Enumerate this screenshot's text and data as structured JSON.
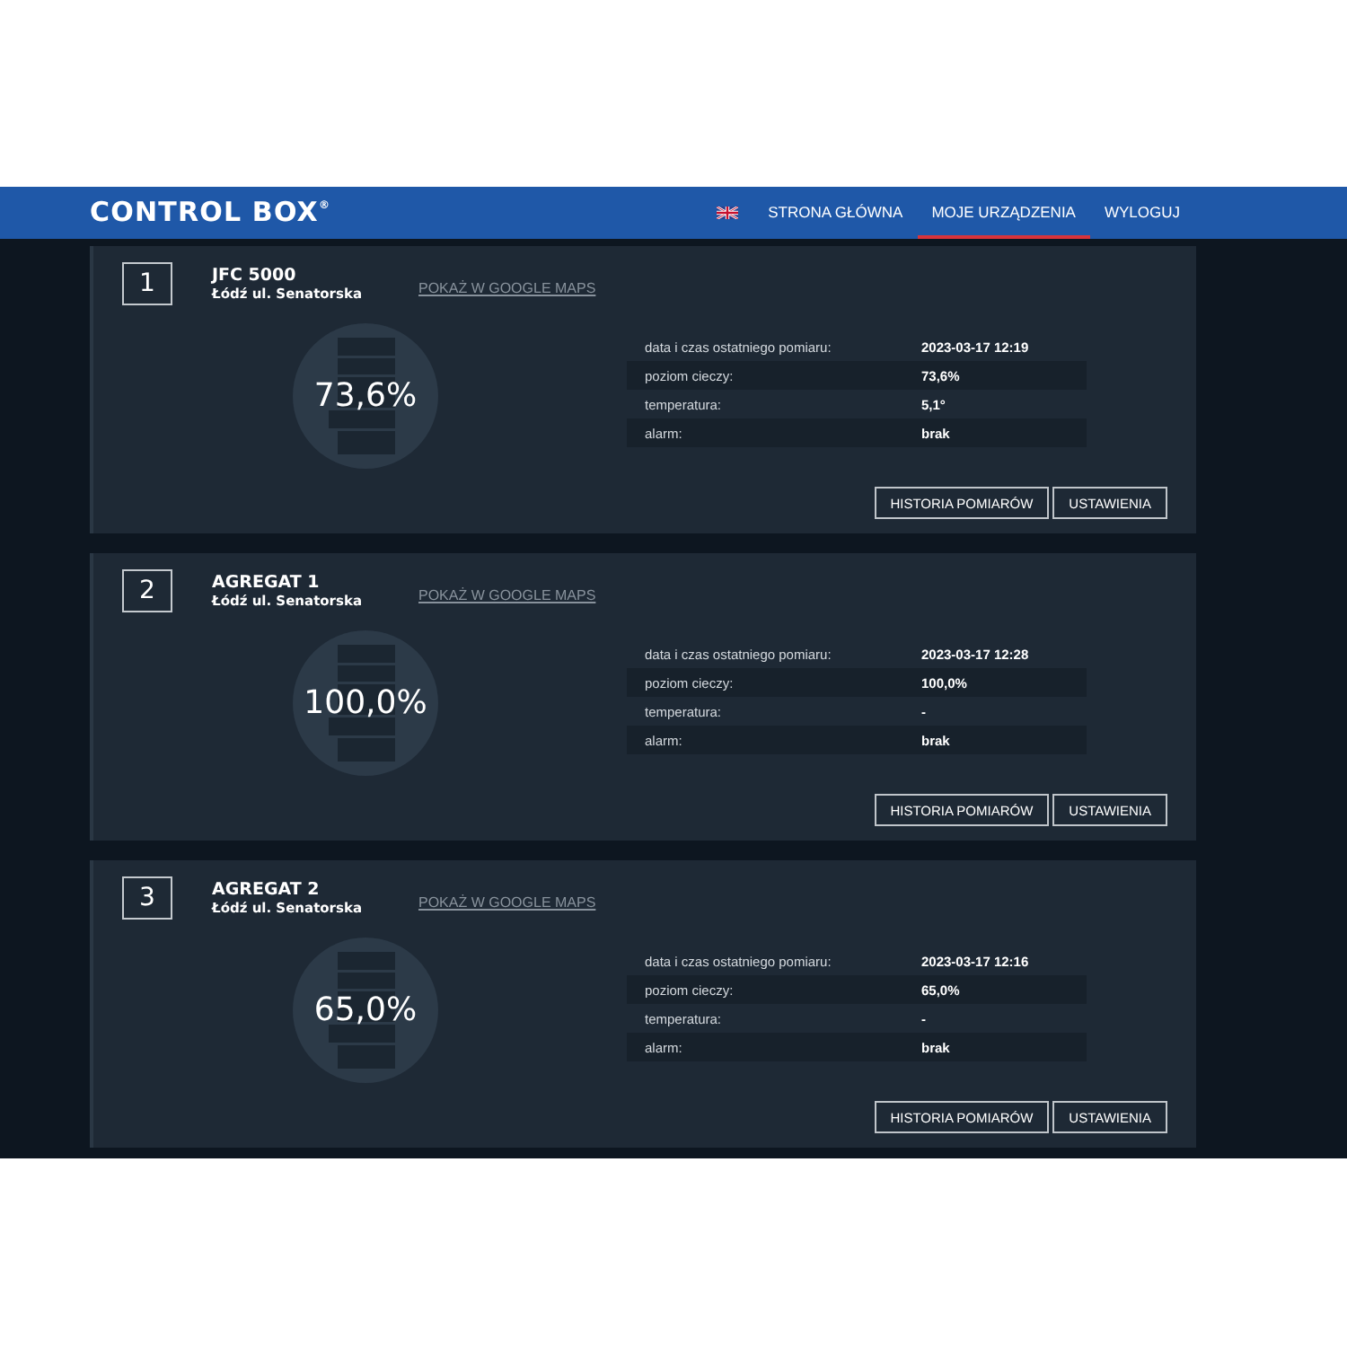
{
  "header": {
    "logo": "CONTROL BOX$^{®}$",
    "nav": [
      {
        "label": "STRONA GŁÓWNA",
        "selected": false
      },
      {
        "label": "MOJE URZĄDZENIA",
        "selected": true
      },
      {
        "label": "WYLOGUJ",
        "selected": false
      }
    ]
  },
  "devices": [
    {
      "number": "1",
      "name": "JFC 5000",
      "location": "Łódź ul. Senatorska",
      "map_link": "POKAŻ W GOOGLE MAPS",
      "reading": "73,6%",
      "details": [
        {
          "label": "data i czas ostatniego pomiaru:",
          "value": "2023-03-17 12:19"
        },
        {
          "label": "poziom cieczy:",
          "value": "73,6%"
        },
        {
          "label": "temperatura:",
          "value": "5,1°"
        },
        {
          "label": "alarm:",
          "value": "brak"
        }
      ],
      "buttons": [
        "HISTORIA POMIARÓW",
        "USTAWIENIA"
      ]
    },
    {
      "number": "2",
      "name": "AGREGAT 1",
      "location": "Łódź ul. Senatorska",
      "map_link": "POKAŻ W GOOGLE MAPS",
      "reading": "100,0%",
      "details": [
        {
          "label": "data i czas ostatniego pomiaru:",
          "value": "2023-03-17 12:28"
        },
        {
          "label": "poziom cieczy:",
          "value": "100,0%"
        },
        {
          "label": "temperatura:",
          "value": "-"
        },
        {
          "label": "alarm:",
          "value": "brak"
        }
      ],
      "buttons": [
        "HISTORIA POMIARÓW",
        "USTAWIENIA"
      ]
    },
    {
      "number": "3",
      "name": "AGREGAT 2",
      "location": "Łódź ul. Senatorska",
      "map_link": "POKAŻ W GOOGLE MAPS",
      "reading": "65,0%",
      "details": [
        {
          "label": "data i czas ostatniego pomiaru:",
          "value": "2023-03-17 12:16"
        },
        {
          "label": "poziom cieczy:",
          "value": "65,0%"
        },
        {
          "label": "temperatura:",
          "value": "-"
        },
        {
          "label": "alarm:",
          "value": "brak"
        }
      ],
      "buttons": [
        "HISTORIA POMIARÓW",
        "USTAWIENIA"
      ]
    }
  ]
}
